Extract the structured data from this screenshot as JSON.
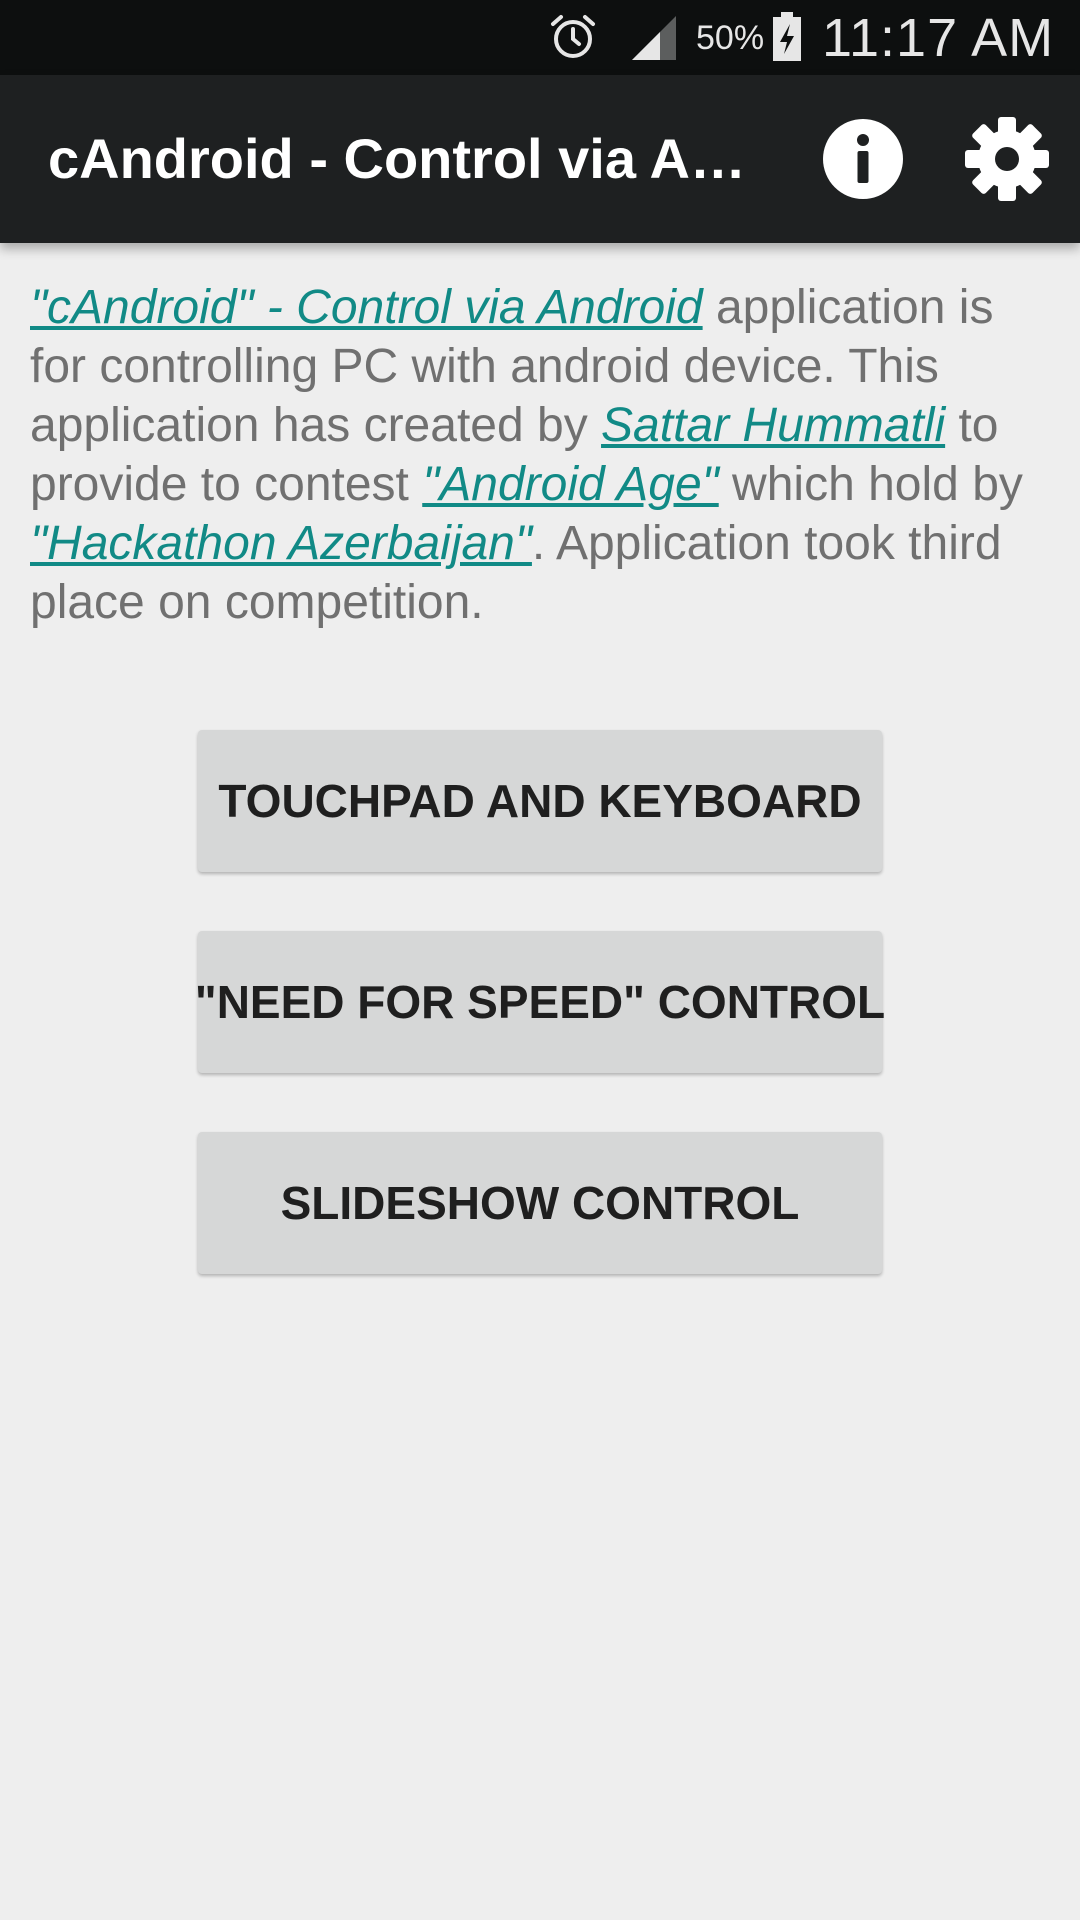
{
  "status_bar": {
    "battery_percent": "50%",
    "time": "11:17 AM",
    "icons": [
      "alarm-icon",
      "signal-icon",
      "battery-charging-icon"
    ]
  },
  "app_bar": {
    "title": "cAndroid - Control via Android",
    "actions": [
      "info-icon",
      "settings-gear-icon"
    ]
  },
  "description": {
    "link_app": "\"cAndroid\" - Control via Android",
    "text_1": " application is for controlling PC with android device. This application has created by ",
    "link_author": "Sattar Hummatli",
    "text_2": " to provide to contest ",
    "link_contest": "\"Android Age\"",
    "text_3": " which hold by ",
    "link_org": "\"Hackathon Azerbaijan\"",
    "text_4": ". Application took third place on competition."
  },
  "buttons": [
    {
      "label": "TOUCHPAD AND KEYBOARD"
    },
    {
      "label": "\"NEED FOR SPEED\" CONTROL"
    },
    {
      "label": "SLIDESHOW CONTROL"
    }
  ],
  "colors": {
    "link": "#118a86",
    "body_text": "#707070",
    "app_bar": "#1e2021",
    "status_bar": "#0d0f0f",
    "background": "#eeeeee",
    "button": "#d6d7d7"
  }
}
